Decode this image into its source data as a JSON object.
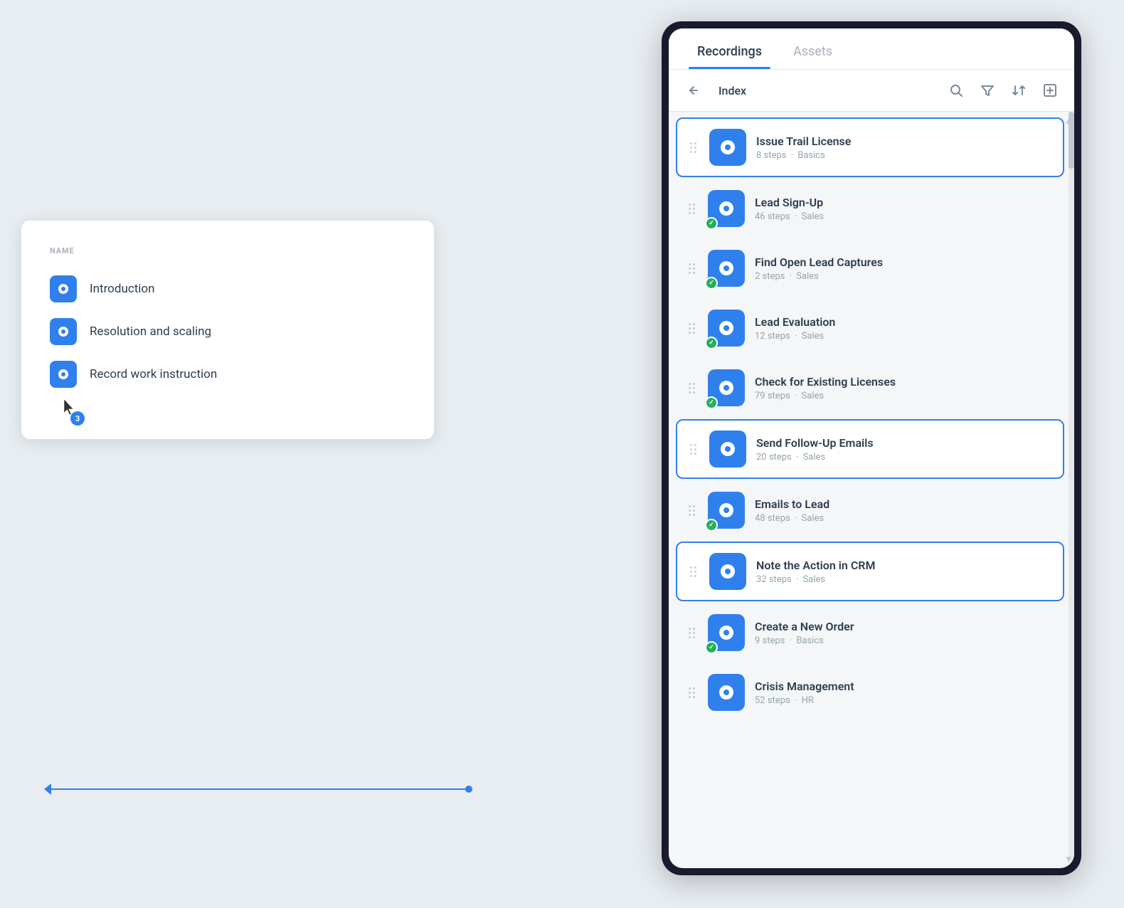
{
  "left_panel": {
    "header": "Name",
    "items": [
      {
        "id": "introduction",
        "label": "Introduction"
      },
      {
        "id": "resolution-scaling",
        "label": "Resolution and scaling"
      },
      {
        "id": "record-work",
        "label": "Record work instruction"
      }
    ]
  },
  "right_panel": {
    "tabs": [
      {
        "id": "recordings",
        "label": "Recordings",
        "active": true
      },
      {
        "id": "assets",
        "label": "Assets",
        "active": false
      }
    ],
    "toolbar": {
      "breadcrumb": "Index",
      "back_icon": "↑",
      "search_icon": "🔍",
      "filter_icon": "▼",
      "sort_icon": "↕",
      "import_icon": "📥"
    },
    "recordings": [
      {
        "id": "issue-trail-license",
        "title": "Issue Trail License",
        "steps": "8",
        "category": "Basics",
        "has_check": false,
        "selected": true
      },
      {
        "id": "lead-signup",
        "title": "Lead Sign-Up",
        "steps": "46",
        "category": "Sales",
        "has_check": true,
        "selected": false
      },
      {
        "id": "find-open-lead",
        "title": "Find Open Lead Captures",
        "steps": "2",
        "category": "Sales",
        "has_check": true,
        "selected": false
      },
      {
        "id": "lead-evaluation",
        "title": "Lead Evaluation",
        "steps": "12",
        "category": "Sales",
        "has_check": true,
        "selected": false
      },
      {
        "id": "check-existing-licenses",
        "title": "Check for Existing Licenses",
        "steps": "79",
        "category": "Sales",
        "has_check": true,
        "selected": false
      },
      {
        "id": "send-follow-up",
        "title": "Send Follow-Up Emails",
        "steps": "20",
        "category": "Sales",
        "has_check": false,
        "selected": true
      },
      {
        "id": "emails-to-lead",
        "title": "Emails to Lead",
        "steps": "48",
        "category": "Sales",
        "has_check": true,
        "selected": false
      },
      {
        "id": "note-action-crm",
        "title": "Note the Action in CRM",
        "steps": "32",
        "category": "Sales",
        "has_check": false,
        "selected": true
      },
      {
        "id": "create-new-order",
        "title": "Create a New Order",
        "steps": "9",
        "category": "Basics",
        "has_check": true,
        "selected": false
      },
      {
        "id": "crisis-management",
        "title": "Crisis Management",
        "steps": "52",
        "category": "HR",
        "has_check": false,
        "selected": false
      }
    ],
    "steps_label": "steps",
    "sep": "·"
  },
  "cursor": {
    "badge": "3"
  }
}
